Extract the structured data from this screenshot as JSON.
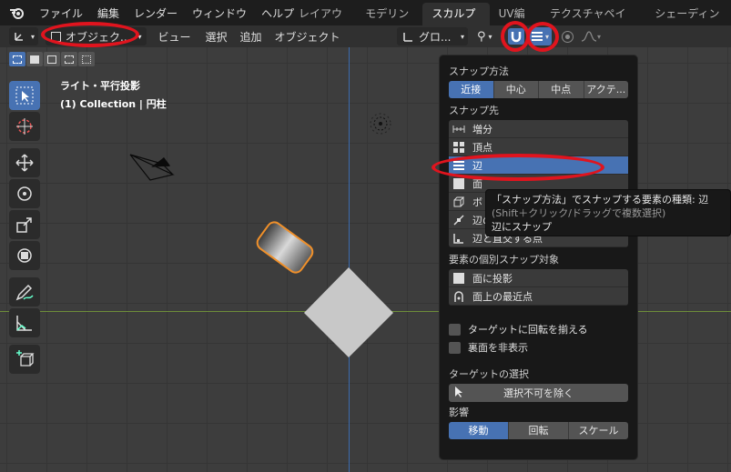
{
  "menubar": {
    "items": [
      "ファイル",
      "編集",
      "レンダー",
      "ウィンドウ",
      "ヘルプ"
    ],
    "workspaces": [
      "レイアウト",
      "モデリング",
      "スカルプト",
      "UV編集",
      "テクスチャペイント",
      "シェーディング"
    ],
    "active_workspace": "スカルプト"
  },
  "header": {
    "mode_label": "オブジェク...",
    "menus": [
      "ビュー",
      "選択",
      "追加",
      "オブジェクト"
    ],
    "orientation_label": "グロ..."
  },
  "viewport": {
    "view_name": "ライト・平行投影",
    "collection_label": "(1) Collection | 円柱"
  },
  "snap_popover": {
    "snap_method_title": "スナップ方法",
    "snap_method_options": [
      "近接",
      "中心",
      "中点",
      "アクテ..."
    ],
    "snap_method_active": "近接",
    "snap_target_title": "スナップ先",
    "snap_targets": [
      {
        "label": "増分",
        "icon": "increment-icon"
      },
      {
        "label": "頂点",
        "icon": "vertex-icon"
      },
      {
        "label": "辺",
        "icon": "edge-icon"
      },
      {
        "label": "面",
        "icon": "face-icon"
      },
      {
        "label": "ボ",
        "icon": "volume-icon"
      },
      {
        "label": "辺の",
        "icon": "edge-center-icon"
      },
      {
        "label": "辺と直交する点",
        "icon": "edge-perpendicular-icon"
      }
    ],
    "snap_target_active": "辺",
    "individual_title": "要素の個別スナップ対象",
    "individual_options": [
      {
        "label": "面に投影",
        "icon": "face-project-icon"
      },
      {
        "label": "面上の最近点",
        "icon": "face-nearest-icon"
      }
    ],
    "checkboxes": [
      "ターゲットに回転を揃える",
      "裏面を非表示"
    ],
    "target_selection_title": "ターゲットの選択",
    "exclude_button": "選択不可を除く",
    "affect_title": "影響",
    "affect_options": [
      "移動",
      "回転",
      "スケール"
    ],
    "affect_active": "移動"
  },
  "tooltip": {
    "line1": "「スナップ方法」でスナップする要素の種類: 辺",
    "line2": "(Shift＋クリック/ドラッグで複数選択)",
    "line3": "辺にスナップ"
  },
  "colors": {
    "accent": "#4772b3",
    "annotation": "#e0141e",
    "x_axis": "#6e8e3a",
    "z_axis": "#3b6baf",
    "selection_outline": "#f0902a"
  }
}
